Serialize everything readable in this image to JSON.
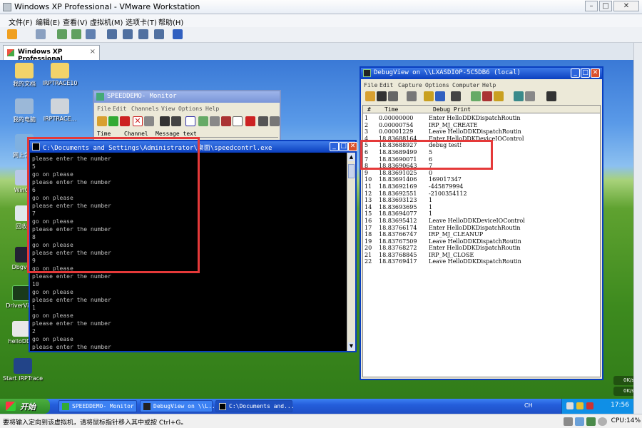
{
  "host": {
    "title": "Windows XP Professional - VMware Workstation",
    "menu": [
      "文件(F)",
      "编辑(E)",
      "查看(V)",
      "虚拟机(M)",
      "选项卡(T)",
      "帮助(H)"
    ],
    "tab_label": "Windows XP Professional",
    "tab_close": "×",
    "status_text": "要将输入定向到该虚拟机，请将鼠标指针移入其中或按 Ctrl+G。",
    "cpu_label": "CPU:14%"
  },
  "desktop_icons": [
    {
      "label": "我的文档"
    },
    {
      "label": "IRPTRACE10"
    },
    {
      "label": "我的电脑"
    },
    {
      "label": "IRPTRACE..."
    },
    {
      "label": "网上邻居"
    },
    {
      "label": "WinObj"
    },
    {
      "label": "回收站"
    },
    {
      "label": "Dbgview"
    },
    {
      "label": "DriverView"
    },
    {
      "label": "helloDDK"
    },
    {
      "label": "Start IRPTrace"
    }
  ],
  "speed_window": {
    "title": "SPEEDDEMO- Monitor",
    "menu": [
      "File",
      "Edit",
      "Channels",
      "View",
      "Options",
      "Help"
    ],
    "columns": [
      "Time",
      "Channel",
      "Message text"
    ]
  },
  "console": {
    "title": "C:\\Documents and Settings\\Administrator\\桌面\\speedcontrl.exe",
    "lines": [
      "please enter the number",
      "5",
      "go on please",
      "please enter the number",
      "6",
      "go on please",
      "please enter the number",
      "7",
      "go on please",
      "please enter the number",
      "8",
      "go on please",
      "please enter the number",
      "9",
      "go on please",
      "please enter the number",
      "10",
      "go on please",
      "please enter the number",
      "1",
      "go on please",
      "please enter the number",
      "2",
      "go on please",
      "please enter the number"
    ]
  },
  "debugview": {
    "title": "DebugView on \\\\LXASDIOP-5C5DB6 (local)",
    "menu": [
      "File",
      "Edit",
      "Capture",
      "Options",
      "Computer",
      "Help"
    ],
    "columns": [
      "#",
      "Time",
      "Debug Print"
    ],
    "rows": [
      {
        "n": "1",
        "time": "0.00000000",
        "msg": "Enter HelloDDKDispatchRoutin"
      },
      {
        "n": "2",
        "time": "0.00000754",
        "msg": " IRP_MJ_CREATE"
      },
      {
        "n": "3",
        "time": "0.00001229",
        "msg": "Leave HelloDDKDispatchRoutin"
      },
      {
        "n": "4",
        "time": "18.83688164",
        "msg": "Enter HelloDDKDeviceIOControl"
      },
      {
        "n": "5",
        "time": "18.83688927",
        "msg": "debug test!"
      },
      {
        "n": "6",
        "time": "18.83689499",
        "msg": "5"
      },
      {
        "n": "7",
        "time": "18.83690071",
        "msg": "6"
      },
      {
        "n": "8",
        "time": "18.83690643",
        "msg": "7"
      },
      {
        "n": "9",
        "time": "18.83691025",
        "msg": "0"
      },
      {
        "n": "10",
        "time": "18.83691406",
        "msg": "169017347"
      },
      {
        "n": "11",
        "time": "18.83692169",
        "msg": "-445879994"
      },
      {
        "n": "12",
        "time": "18.83692551",
        "msg": "-2100354112"
      },
      {
        "n": "13",
        "time": "18.83693123",
        "msg": "1"
      },
      {
        "n": "14",
        "time": "18.83693695",
        "msg": "1"
      },
      {
        "n": "15",
        "time": "18.83694077",
        "msg": "1"
      },
      {
        "n": "16",
        "time": "18.83695412",
        "msg": "Leave HelloDDKDeviceIOControl"
      },
      {
        "n": "17",
        "time": "18.83766174",
        "msg": "Enter HelloDDKDispatchRoutin"
      },
      {
        "n": "18",
        "time": "18.83766747",
        "msg": " IRP_MJ_CLEANUP"
      },
      {
        "n": "19",
        "time": "18.83767509",
        "msg": "Leave HelloDDKDispatchRoutin"
      },
      {
        "n": "20",
        "time": "18.83768272",
        "msg": "Enter HelloDDKDispatchRoutin"
      },
      {
        "n": "21",
        "time": "18.83768845",
        "msg": " IRP_MJ_CLOSE"
      },
      {
        "n": "22",
        "time": "18.83769417",
        "msg": "Leave HelloDDKDispatchRoutin"
      }
    ]
  },
  "taskbar": {
    "start_label": "开始",
    "tasks": [
      "SPEEDDEMO- Monitor",
      "DebugView on \\\\L...",
      "C:\\Documents and..."
    ],
    "lang": "CH",
    "clock": "17:56"
  },
  "net_speed": [
    "0K/s",
    "0K/s"
  ]
}
